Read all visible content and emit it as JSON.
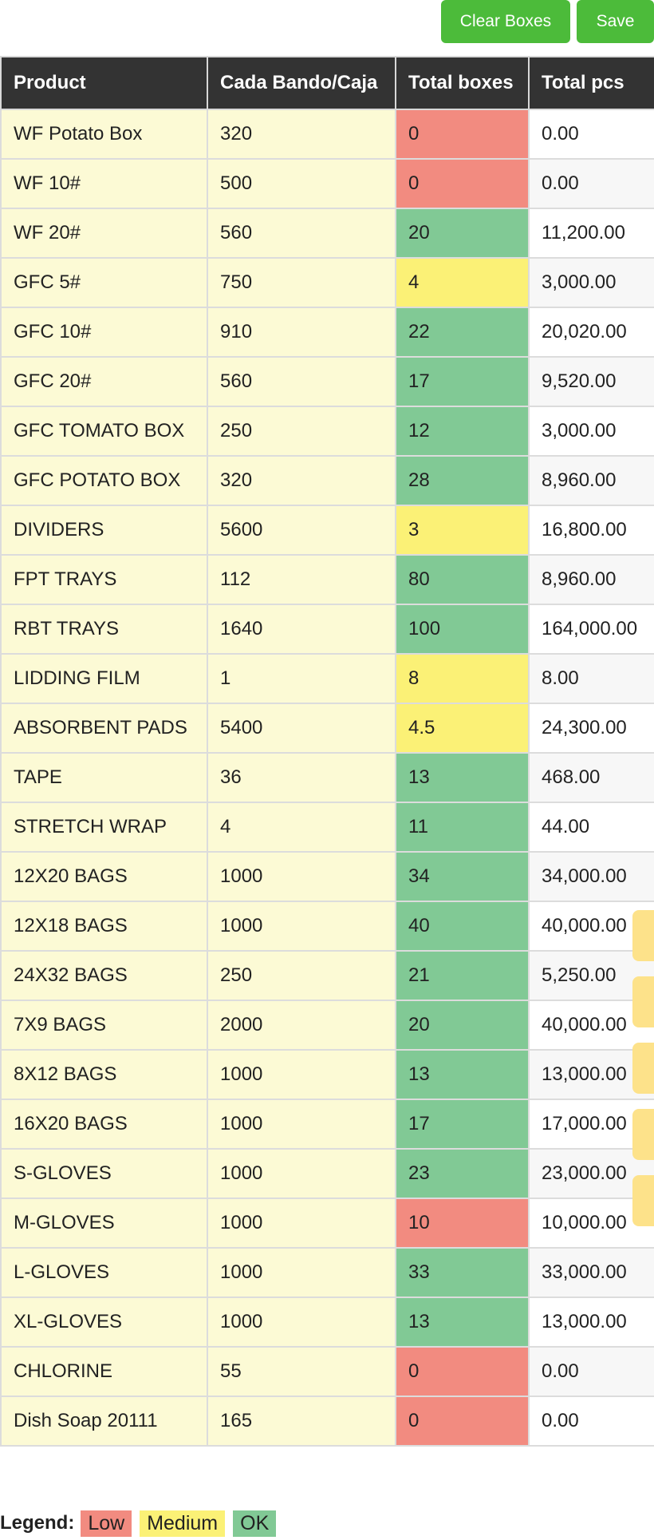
{
  "toolbar": {
    "clear_label": "Clear Boxes",
    "save_label": "Save",
    "button_color": "#4cbb3a"
  },
  "table": {
    "headers": [
      "Product",
      "Cada Bando/Caja",
      "Total boxes",
      "Total pcs"
    ],
    "rows": [
      {
        "product": "WF Potato Box",
        "cada": "320",
        "boxes": "0",
        "pcs": "0.00",
        "status": "low"
      },
      {
        "product": "WF 10#",
        "cada": "500",
        "boxes": "0",
        "pcs": "0.00",
        "status": "low"
      },
      {
        "product": "WF 20#",
        "cada": "560",
        "boxes": "20",
        "pcs": "11,200.00",
        "status": "ok"
      },
      {
        "product": "GFC 5#",
        "cada": "750",
        "boxes": "4",
        "pcs": "3,000.00",
        "status": "medium"
      },
      {
        "product": "GFC 10#",
        "cada": "910",
        "boxes": "22",
        "pcs": "20,020.00",
        "status": "ok"
      },
      {
        "product": "GFC 20#",
        "cada": "560",
        "boxes": "17",
        "pcs": "9,520.00",
        "status": "ok"
      },
      {
        "product": "GFC TOMATO BOX",
        "cada": "250",
        "boxes": "12",
        "pcs": "3,000.00",
        "status": "ok"
      },
      {
        "product": "GFC POTATO BOX",
        "cada": "320",
        "boxes": "28",
        "pcs": "8,960.00",
        "status": "ok"
      },
      {
        "product": "DIVIDERS",
        "cada": "5600",
        "boxes": "3",
        "pcs": "16,800.00",
        "status": "medium"
      },
      {
        "product": "FPT TRAYS",
        "cada": "112",
        "boxes": "80",
        "pcs": "8,960.00",
        "status": "ok"
      },
      {
        "product": "RBT TRAYS",
        "cada": "1640",
        "boxes": "100",
        "pcs": "164,000.00",
        "status": "ok"
      },
      {
        "product": "LIDDING FILM",
        "cada": "1",
        "boxes": "8",
        "pcs": "8.00",
        "status": "medium"
      },
      {
        "product": "ABSORBENT  PADS",
        "cada": "5400",
        "boxes": "4.5",
        "pcs": "24,300.00",
        "status": "medium"
      },
      {
        "product": "TAPE",
        "cada": "36",
        "boxes": "13",
        "pcs": "468.00",
        "status": "ok"
      },
      {
        "product": "STRETCH  WRAP",
        "cada": "4",
        "boxes": "11",
        "pcs": "44.00",
        "status": "ok"
      },
      {
        "product": "12X20 BAGS",
        "cada": "1000",
        "boxes": "34",
        "pcs": "34,000.00",
        "status": "ok"
      },
      {
        "product": "12X18 BAGS",
        "cada": "1000",
        "boxes": "40",
        "pcs": "40,000.00",
        "status": "ok"
      },
      {
        "product": "24X32 BAGS",
        "cada": "250",
        "boxes": "21",
        "pcs": "5,250.00",
        "status": "ok"
      },
      {
        "product": "7X9 BAGS",
        "cada": "2000",
        "boxes": "20",
        "pcs": "40,000.00",
        "status": "ok"
      },
      {
        "product": "8X12 BAGS",
        "cada": "1000",
        "boxes": "13",
        "pcs": "13,000.00",
        "status": "ok"
      },
      {
        "product": "16X20 BAGS",
        "cada": "1000",
        "boxes": "17",
        "pcs": "17,000.00",
        "status": "ok"
      },
      {
        "product": "S-GLOVES",
        "cada": "1000",
        "boxes": "23",
        "pcs": "23,000.00",
        "status": "ok"
      },
      {
        "product": "M-GLOVES",
        "cada": "1000",
        "boxes": "10",
        "pcs": "10,000.00",
        "status": "low"
      },
      {
        "product": "L-GLOVES",
        "cada": "1000",
        "boxes": "33",
        "pcs": "33,000.00",
        "status": "ok"
      },
      {
        "product": "XL-GLOVES",
        "cada": "1000",
        "boxes": "13",
        "pcs": "13,000.00",
        "status": "ok"
      },
      {
        "product": "CHLORINE",
        "cada": "55",
        "boxes": "0",
        "pcs": "0.00",
        "status": "low"
      },
      {
        "product": "Dish Soap 20111",
        "cada": "165",
        "boxes": "0",
        "pcs": "0.00",
        "status": "low"
      }
    ]
  },
  "legend": {
    "title": "Legend:",
    "items": [
      {
        "label": "Low",
        "status": "low"
      },
      {
        "label": "Medium",
        "status": "medium"
      },
      {
        "label": "OK",
        "status": "ok"
      }
    ]
  },
  "colors": {
    "header_bg": "#333333",
    "product_bg": "#fcfad5",
    "low": "#f28b80",
    "medium": "#fbf176",
    "ok": "#81c995",
    "side_tab": "#fde28a"
  }
}
